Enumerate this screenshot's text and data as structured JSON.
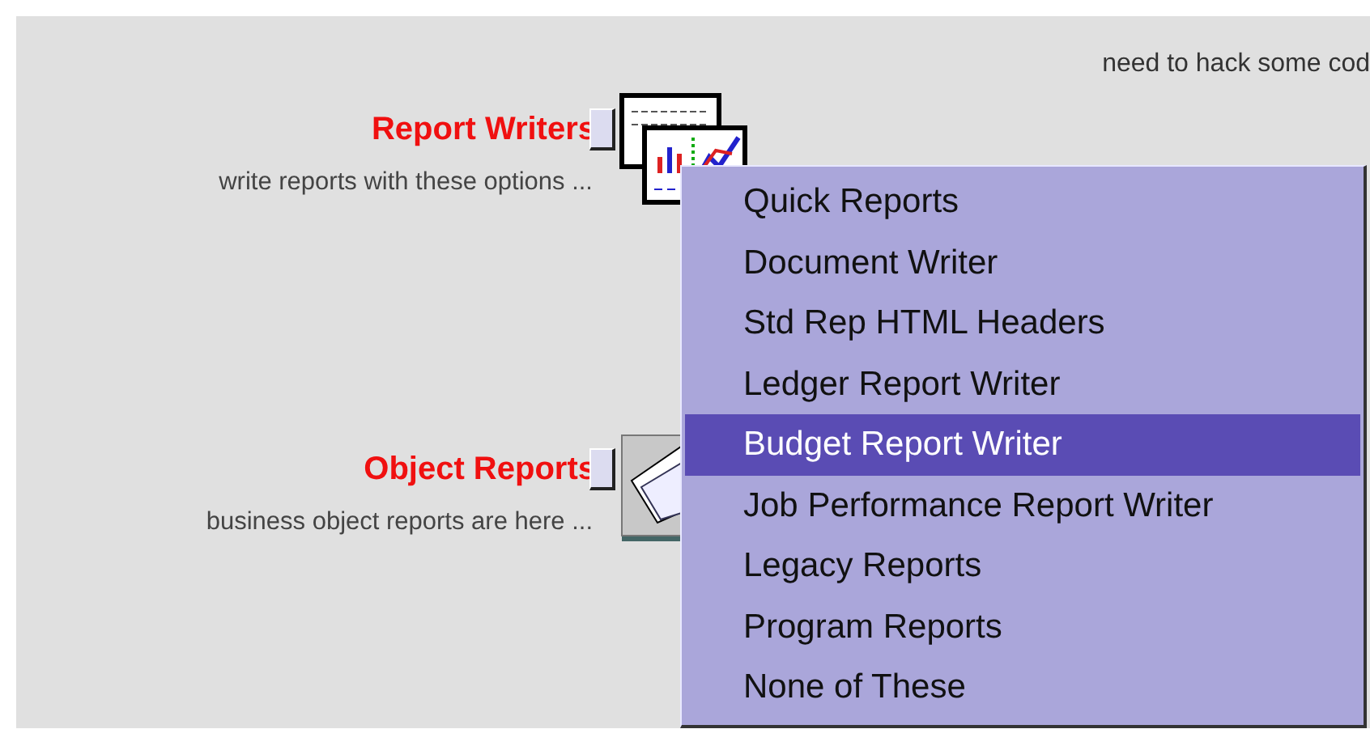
{
  "note": "need to hack some cod",
  "sections": [
    {
      "title": "Report Writers",
      "description": "write reports with these options ...",
      "kind": "chart"
    },
    {
      "title": "Object Reports",
      "description": "business object reports are here ...",
      "kind": "papers"
    }
  ],
  "menu": {
    "items": [
      {
        "label": "Quick Reports",
        "selected": false
      },
      {
        "label": "Document Writer",
        "selected": false
      },
      {
        "label": "Std Rep HTML Headers",
        "selected": false
      },
      {
        "label": "Ledger Report Writer",
        "selected": false
      },
      {
        "label": "Budget Report Writer",
        "selected": true
      },
      {
        "label": "Job Performance Report Writer",
        "selected": false
      },
      {
        "label": "Legacy Reports",
        "selected": false
      },
      {
        "label": "Program Reports",
        "selected": false
      },
      {
        "label": "None of These",
        "selected": false
      }
    ]
  }
}
